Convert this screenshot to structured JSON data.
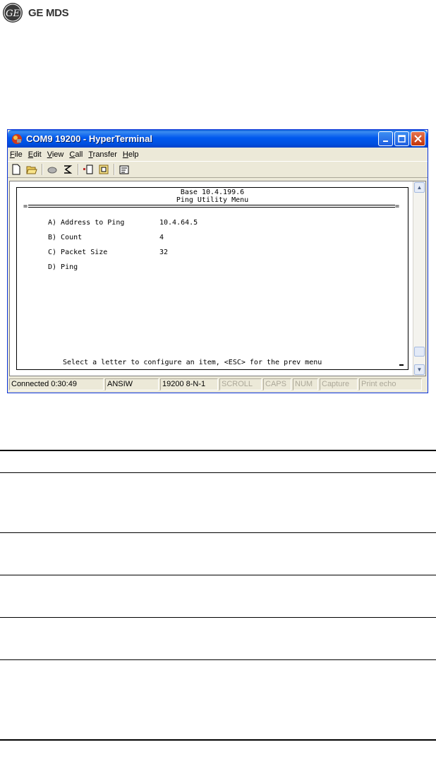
{
  "brand": {
    "text": "GE MDS"
  },
  "window": {
    "title": "COM9 19200 - HyperTerminal",
    "menu": [
      {
        "pre": "",
        "accel": "F",
        "post": "ile"
      },
      {
        "pre": "",
        "accel": "E",
        "post": "dit"
      },
      {
        "pre": "",
        "accel": "V",
        "post": "iew"
      },
      {
        "pre": "",
        "accel": "C",
        "post": "all"
      },
      {
        "pre": "",
        "accel": "T",
        "post": "ransfer"
      },
      {
        "pre": "",
        "accel": "H",
        "post": "elp"
      }
    ],
    "toolbar": [
      "new-icon",
      "open-icon",
      "disconnect-icon",
      "call-icon",
      "send-icon",
      "receive-icon",
      "properties-icon"
    ]
  },
  "terminal": {
    "header1": "Base 10.4.199.6",
    "header2": "Ping Utility Menu",
    "items": [
      {
        "key": "A) Address to Ping",
        "value": "10.4.64.5"
      },
      {
        "key": "B) Count",
        "value": "4"
      },
      {
        "key": "C) Packet Size",
        "value": "32"
      },
      {
        "key": "D) Ping",
        "value": ""
      }
    ],
    "footer": "Select a letter to configure an item, <ESC> for the prev menu"
  },
  "status": {
    "connected": "Connected 0:30:49",
    "emulation": "ANSIW",
    "settings": "19200 8-N-1",
    "scroll": "SCROLL",
    "caps": "CAPS",
    "num": "NUM",
    "capture": "Capture",
    "print": "Print echo"
  },
  "colors": {
    "titlebar": "#0058ee",
    "window_bg": "#ece9d8",
    "close": "#c2350a"
  }
}
